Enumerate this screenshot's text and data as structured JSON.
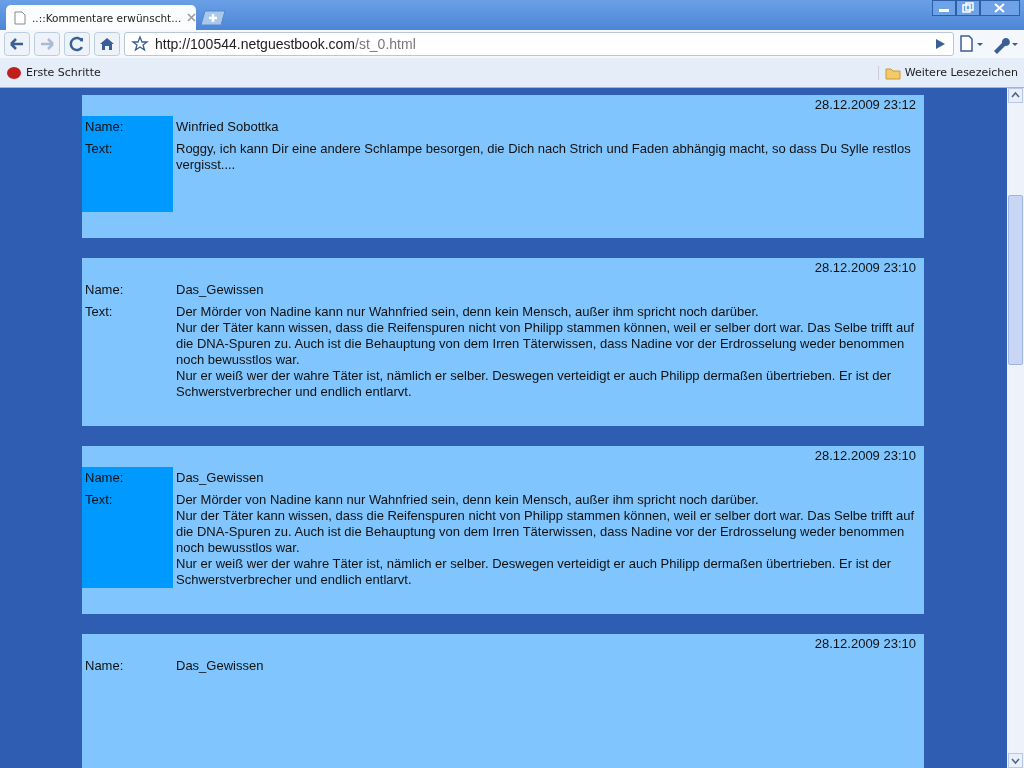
{
  "browser": {
    "tab_title": "..::Kommentare erwünscht...",
    "url_host": "http://100544.netguestbook.com",
    "url_path": "/st_0.html",
    "bookmarks": [
      "Erste Schritte"
    ],
    "other_bookmarks": "Weitere Lesezeichen"
  },
  "entries": [
    {
      "date": "28.12.2009 23:12",
      "highlighted": true,
      "name_label": "Name:",
      "name": "Winfried Sobottka",
      "text_label": "Text:",
      "text": [
        "Roggy, ich kann Dir eine andere Schlampe besorgen, die Dich nach Strich und Faden abhängig macht, so dass Du Sylle restlos vergisst...."
      ]
    },
    {
      "date": "28.12.2009 23:10",
      "highlighted": false,
      "name_label": "Name:",
      "name": "Das_Gewissen",
      "text_label": "Text:",
      "text": [
        "Der Mörder von Nadine kann nur Wahnfried sein, denn kein Mensch, außer ihm spricht noch darüber.",
        "Nur der Täter kann wissen, dass die Reifenspuren nicht von Philipp stammen können, weil er selber dort war. Das Selbe trifft auf die DNA-Spuren zu. Auch ist die Behauptung von dem Irren Täterwissen, dass Nadine vor der Erdrosselung weder benommen noch bewusstlos war.",
        "Nur er weiß wer der wahre Täter ist, nämlich er selber. Deswegen verteidigt er auch Philipp dermaßen übertrieben. Er ist der Schwerstverbrecher und endlich entlarvt."
      ]
    },
    {
      "date": "28.12.2009 23:10",
      "highlighted": true,
      "name_label": "Name:",
      "name": "Das_Gewissen",
      "text_label": "Text:",
      "text": [
        "Der Mörder von Nadine kann nur Wahnfried sein, denn kein Mensch, außer ihm spricht noch darüber.",
        "Nur der Täter kann wissen, dass die Reifenspuren nicht von Philipp stammen können, weil er selber dort war. Das Selbe trifft auf die DNA-Spuren zu. Auch ist die Behauptung von dem Irren Täterwissen, dass Nadine vor der Erdrosselung weder benommen noch bewusstlos war.",
        "Nur er weiß wer der wahre Täter ist, nämlich er selber. Deswegen verteidigt er auch Philipp dermaßen übertrieben. Er ist der Schwerstverbrecher und endlich entlarvt."
      ]
    },
    {
      "date": "28.12.2009 23:10",
      "highlighted": false,
      "name_label": "Name:",
      "name": "Das_Gewissen"
    }
  ]
}
